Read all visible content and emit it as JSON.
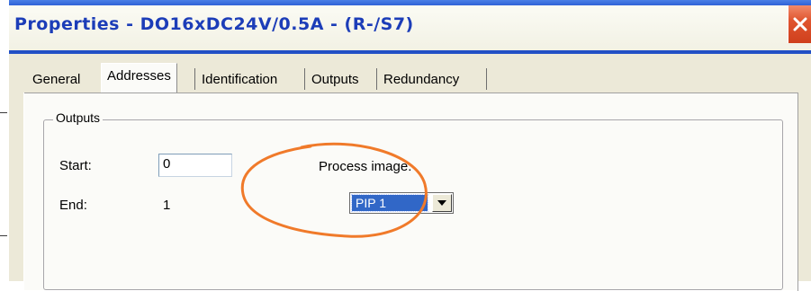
{
  "window": {
    "title": "Properties - DO16xDC24V/0.5A - (R-/S7)"
  },
  "tabs": [
    {
      "label": "General"
    },
    {
      "label": "Addresses"
    },
    {
      "label": "Identification"
    },
    {
      "label": "Outputs"
    },
    {
      "label": "Redundancy"
    }
  ],
  "active_tab": "Addresses",
  "outputs_group": {
    "title": "Outputs",
    "start_label": "Start:",
    "start_value": "0",
    "end_label": "End:",
    "end_value": "1",
    "process_image_label": "Process image:",
    "process_image_value": "PIP 1"
  },
  "colors": {
    "titlebar_blue": "#1f4cc7",
    "close_red": "#e0552f",
    "selection_blue": "#3167c7",
    "annotation_orange": "#f07a2a",
    "dialog_face": "#ece9d8"
  },
  "icons": {
    "close": "close-icon",
    "dropdown": "chevron-down-icon"
  }
}
